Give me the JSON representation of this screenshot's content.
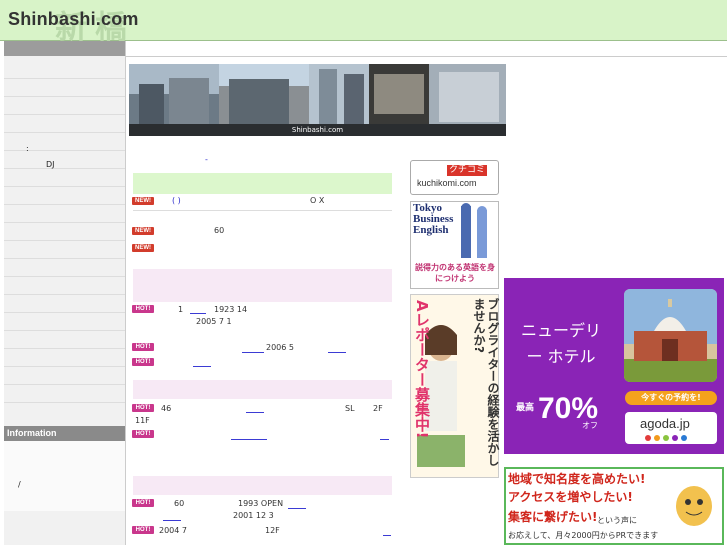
{
  "header": {
    "logo": "Shinbashi.com",
    "kanji": "新橋"
  },
  "sidebar": {
    "items": [
      {
        "label": ":"
      },
      {
        "label": "DJ"
      }
    ],
    "info_heading": "Information",
    "info_text": "/"
  },
  "banner": {
    "label": "Shinbashi.com"
  },
  "intro": {
    "dash": "-"
  },
  "news_new": [
    {
      "badge": "NEW!",
      "text": "(        )",
      "tail": "O X"
    },
    {
      "badge": "NEW!",
      "text": "60"
    },
    {
      "badge": "NEW!",
      "text": ""
    }
  ],
  "news_hot1": [
    {
      "badge": "HOT!",
      "text": "1",
      "mid": "1923   14",
      "line2": "2005 7 1"
    },
    {
      "badge": "HOT!",
      "text": "2006 5"
    },
    {
      "badge": "HOT!",
      "text": ""
    }
  ],
  "news_hot2": [
    {
      "badge": "HOT!",
      "text": "46",
      "mid": "SL",
      "tail": "2F",
      "line2": "11F"
    },
    {
      "badge": "HOT!",
      "text": ""
    }
  ],
  "news_hot3": [
    {
      "badge": "HOT!",
      "text": "60",
      "mid": "1993  OPEN",
      "line2": "2001 12          3"
    },
    {
      "badge": "HOT!",
      "text": "2004 7",
      "mid": "12F"
    }
  ],
  "ads": {
    "kuchikomi_tag": "クチコミ",
    "kuchikomi_url": "kuchikomi.com",
    "tbe_title": "Tokyo Business English",
    "tbe_sub": "説得力のある英語を身につけよう",
    "blog_vertical_a": "Aレポーター募集中!",
    "blog_vertical_b": "ブログライターの経験を活かしませんか?",
    "agoda_hotel": "ニューデリー ホテル",
    "agoda_pre": "最高",
    "agoda_pct": "70%",
    "agoda_off": "オフ",
    "agoda_btn": "今すぐの予約を!",
    "agoda_logo": "agoda.jp",
    "pr_l1": "地域で知名度を高めたい!",
    "pr_l2": "アクセスを増やしたい!",
    "pr_l3": "集客に繋げたい!",
    "pr_l3small": "という声に",
    "pr_l4": "お応えして、月々2000円からPRできます"
  },
  "colors": {
    "header_bg": "#d8f3c8",
    "accent_purple": "#8a24b6",
    "new_badge": "#d23c2c",
    "hot_badge": "#c9378c"
  }
}
